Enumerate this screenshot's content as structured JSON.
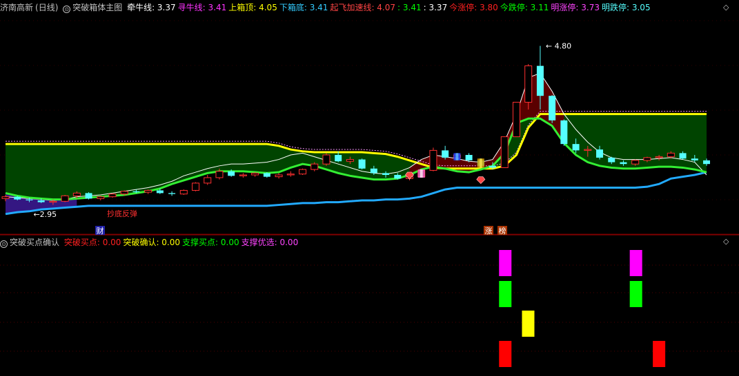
{
  "main_header": {
    "stock": "济南高新",
    "period": "(日线)",
    "indicator": "突破箱体主图",
    "fields": [
      {
        "label": "牵牛线:",
        "value": "3.37",
        "color": "#ffffff"
      },
      {
        "label": "寻牛线:",
        "value": "3.41",
        "color": "#ff33ff"
      },
      {
        "label": "上箱顶:",
        "value": "4.05",
        "color": "#ffff00"
      },
      {
        "label": "下箱底:",
        "value": "3.41",
        "color": "#33ccff"
      },
      {
        "label": "起飞加速线:",
        "value": "4.07",
        "color": "#ff4444"
      },
      {
        "label": ":",
        "value": "3.41",
        "color": "#00ff00"
      },
      {
        "label": ":",
        "value": "3.37",
        "color": "#ffffff"
      },
      {
        "label": "今涨停:",
        "value": "3.80",
        "color": "#ff2020"
      },
      {
        "label": "今跌停:",
        "value": "3.11",
        "color": "#00ff00"
      },
      {
        "label": "明涨停:",
        "value": "3.73",
        "color": "#ff44ff"
      },
      {
        "label": "明跌停:",
        "value": "3.05",
        "color": "#55ffff"
      }
    ]
  },
  "sub_header": {
    "indicator": "突破买点确认",
    "fields": [
      {
        "label": "突破买点:",
        "value": "0.00",
        "color": "#ff2020"
      },
      {
        "label": "突破确认:",
        "value": "0.00",
        "color": "#ffff00"
      },
      {
        "label": "支撑买点:",
        "value": "0.00",
        "color": "#00ff00"
      },
      {
        "label": "支撑优选:",
        "value": "0.00",
        "color": "#ff44ff"
      }
    ]
  },
  "icons": [
    "circle-menu-icon",
    "diamond-collapse-icon",
    "gem-signal-icon"
  ],
  "chart_data": [
    {
      "type": "candlestick",
      "max_annotation": "4.80",
      "min_annotation": "2.95",
      "signal_text": "抄底反弹",
      "bottom_markers": [
        "财",
        "涨",
        "榜"
      ],
      "ohlc": [
        [
          3.12,
          3.16,
          3.09,
          3.14
        ],
        [
          3.14,
          3.15,
          3.1,
          3.11
        ],
        [
          3.11,
          3.13,
          3.08,
          3.1
        ],
        [
          3.1,
          3.12,
          3.07,
          3.08
        ],
        [
          3.08,
          3.11,
          3.05,
          3.09
        ],
        [
          3.09,
          3.16,
          3.08,
          3.15
        ],
        [
          3.15,
          3.2,
          3.12,
          3.18
        ],
        [
          3.18,
          3.19,
          3.11,
          3.12
        ],
        [
          3.12,
          3.15,
          3.1,
          3.14
        ],
        [
          3.14,
          3.18,
          3.13,
          3.17
        ],
        [
          3.17,
          3.21,
          3.15,
          3.2
        ],
        [
          3.2,
          3.22,
          3.18,
          3.19
        ],
        [
          3.19,
          3.22,
          3.17,
          3.21
        ],
        [
          3.21,
          3.23,
          3.17,
          3.18
        ],
        [
          3.18,
          3.2,
          3.15,
          3.17
        ],
        [
          3.17,
          3.22,
          3.16,
          3.21
        ],
        [
          3.21,
          3.3,
          3.2,
          3.29
        ],
        [
          3.29,
          3.38,
          3.27,
          3.35
        ],
        [
          3.35,
          3.45,
          3.33,
          3.42
        ],
        [
          3.42,
          3.44,
          3.36,
          3.37
        ],
        [
          3.37,
          3.4,
          3.35,
          3.38
        ],
        [
          3.38,
          3.41,
          3.36,
          3.4
        ],
        [
          3.4,
          3.41,
          3.35,
          3.36
        ],
        [
          3.36,
          3.4,
          3.34,
          3.38
        ],
        [
          3.38,
          3.42,
          3.36,
          3.39
        ],
        [
          3.39,
          3.45,
          3.38,
          3.44
        ],
        [
          3.44,
          3.52,
          3.42,
          3.5
        ],
        [
          3.5,
          3.62,
          3.48,
          3.6
        ],
        [
          3.6,
          3.64,
          3.52,
          3.53
        ],
        [
          3.53,
          3.58,
          3.5,
          3.55
        ],
        [
          3.55,
          3.56,
          3.44,
          3.45
        ],
        [
          3.45,
          3.48,
          3.38,
          3.4
        ],
        [
          3.4,
          3.42,
          3.35,
          3.38
        ],
        [
          3.38,
          3.4,
          3.33,
          3.34
        ],
        [
          3.34,
          3.38,
          3.32,
          3.36
        ],
        [
          3.36,
          3.44,
          3.35,
          3.43
        ],
        [
          3.43,
          3.68,
          3.42,
          3.65
        ],
        [
          3.65,
          3.7,
          3.55,
          3.57
        ],
        [
          3.57,
          3.62,
          3.54,
          3.6
        ],
        [
          3.6,
          3.62,
          3.52,
          3.54
        ],
        [
          3.54,
          3.56,
          3.46,
          3.48
        ],
        [
          3.48,
          3.52,
          3.44,
          3.46
        ],
        [
          3.46,
          3.8,
          3.46,
          3.8
        ],
        [
          3.8,
          4.18,
          3.8,
          4.18
        ],
        [
          4.18,
          4.6,
          4.1,
          4.58
        ],
        [
          4.58,
          4.8,
          4.1,
          4.25
        ],
        [
          4.25,
          4.26,
          3.95,
          3.98
        ],
        [
          3.98,
          3.99,
          3.7,
          3.72
        ],
        [
          3.72,
          3.78,
          3.62,
          3.65
        ],
        [
          3.65,
          3.7,
          3.58,
          3.66
        ],
        [
          3.66,
          3.7,
          3.55,
          3.57
        ],
        [
          3.57,
          3.58,
          3.5,
          3.52
        ],
        [
          3.52,
          3.54,
          3.48,
          3.5
        ],
        [
          3.5,
          3.55,
          3.48,
          3.54
        ],
        [
          3.54,
          3.58,
          3.52,
          3.57
        ],
        [
          3.57,
          3.6,
          3.54,
          3.58
        ],
        [
          3.58,
          3.64,
          3.56,
          3.62
        ],
        [
          3.62,
          3.64,
          3.55,
          3.56
        ],
        [
          3.56,
          3.6,
          3.52,
          3.54
        ],
        [
          3.54,
          3.56,
          3.48,
          3.5
        ]
      ],
      "upper_box": [
        3.72,
        3.72,
        3.72,
        3.72,
        3.72,
        3.72,
        3.72,
        3.72,
        3.72,
        3.72,
        3.72,
        3.72,
        3.72,
        3.72,
        3.72,
        3.72,
        3.72,
        3.72,
        3.72,
        3.72,
        3.72,
        3.72,
        3.72,
        3.7,
        3.66,
        3.64,
        3.63,
        3.63,
        3.63,
        3.63,
        3.63,
        3.62,
        3.61,
        3.58,
        3.54,
        3.5,
        3.46,
        3.45,
        3.45,
        3.45,
        3.45,
        3.45,
        3.48,
        3.6,
        3.9,
        4.05,
        4.05,
        4.05,
        4.05,
        4.05,
        4.05,
        4.05,
        4.05,
        4.05,
        4.05,
        4.05,
        4.05,
        4.05,
        4.05,
        4.05
      ],
      "lower_box": [
        2.95,
        2.97,
        2.98,
        3.0,
        3.01,
        3.02,
        3.03,
        3.04,
        3.04,
        3.04,
        3.04,
        3.04,
        3.04,
        3.04,
        3.04,
        3.04,
        3.04,
        3.04,
        3.04,
        3.04,
        3.04,
        3.04,
        3.04,
        3.05,
        3.06,
        3.07,
        3.07,
        3.08,
        3.08,
        3.09,
        3.1,
        3.1,
        3.11,
        3.11,
        3.12,
        3.14,
        3.18,
        3.22,
        3.24,
        3.24,
        3.24,
        3.24,
        3.24,
        3.24,
        3.24,
        3.24,
        3.24,
        3.24,
        3.24,
        3.24,
        3.24,
        3.24,
        3.24,
        3.24,
        3.25,
        3.28,
        3.34,
        3.36,
        3.38,
        3.41
      ],
      "green_line": [
        3.18,
        3.15,
        3.13,
        3.12,
        3.11,
        3.11,
        3.12,
        3.13,
        3.14,
        3.15,
        3.16,
        3.18,
        3.2,
        3.23,
        3.28,
        3.32,
        3.36,
        3.4,
        3.42,
        3.42,
        3.42,
        3.41,
        3.4,
        3.41,
        3.46,
        3.5,
        3.48,
        3.44,
        3.4,
        3.37,
        3.35,
        3.33,
        3.33,
        3.34,
        3.38,
        3.44,
        3.47,
        3.45,
        3.42,
        3.41,
        3.44,
        3.48,
        3.62,
        3.95,
        4.0,
        4.0,
        3.92,
        3.73,
        3.6,
        3.52,
        3.48,
        3.46,
        3.45,
        3.45,
        3.46,
        3.47,
        3.47,
        3.46,
        3.44,
        3.41
      ],
      "white_line": [
        3.14,
        3.13,
        3.12,
        3.11,
        3.1,
        3.11,
        3.14,
        3.15,
        3.16,
        3.18,
        3.2,
        3.22,
        3.24,
        3.27,
        3.31,
        3.37,
        3.41,
        3.45,
        3.48,
        3.5,
        3.5,
        3.51,
        3.52,
        3.55,
        3.6,
        3.62,
        3.58,
        3.54,
        3.5,
        3.46,
        3.42,
        3.4,
        3.39,
        3.41,
        3.46,
        3.55,
        3.6,
        3.58,
        3.56,
        3.53,
        3.52,
        3.55,
        3.75,
        4.05,
        4.45,
        4.5,
        4.3,
        4.05,
        3.88,
        3.74,
        3.63,
        3.57,
        3.55,
        3.55,
        3.55,
        3.56,
        3.57,
        3.55,
        3.52,
        3.38
      ]
    },
    {
      "type": "bar",
      "series": [
        {
          "name": "突破买点",
          "color": "#ff0000",
          "points": [
            42,
            55
          ]
        },
        {
          "name": "突破确认",
          "color": "#ffff00",
          "points": [
            43
          ]
        },
        {
          "name": "支撑买点",
          "color": "#00ff00",
          "points": [
            42,
            53
          ]
        },
        {
          "name": "支撑优选",
          "color": "#ff00ff",
          "points": [
            42,
            53
          ]
        }
      ],
      "values": [
        1,
        1,
        1,
        1
      ]
    }
  ]
}
